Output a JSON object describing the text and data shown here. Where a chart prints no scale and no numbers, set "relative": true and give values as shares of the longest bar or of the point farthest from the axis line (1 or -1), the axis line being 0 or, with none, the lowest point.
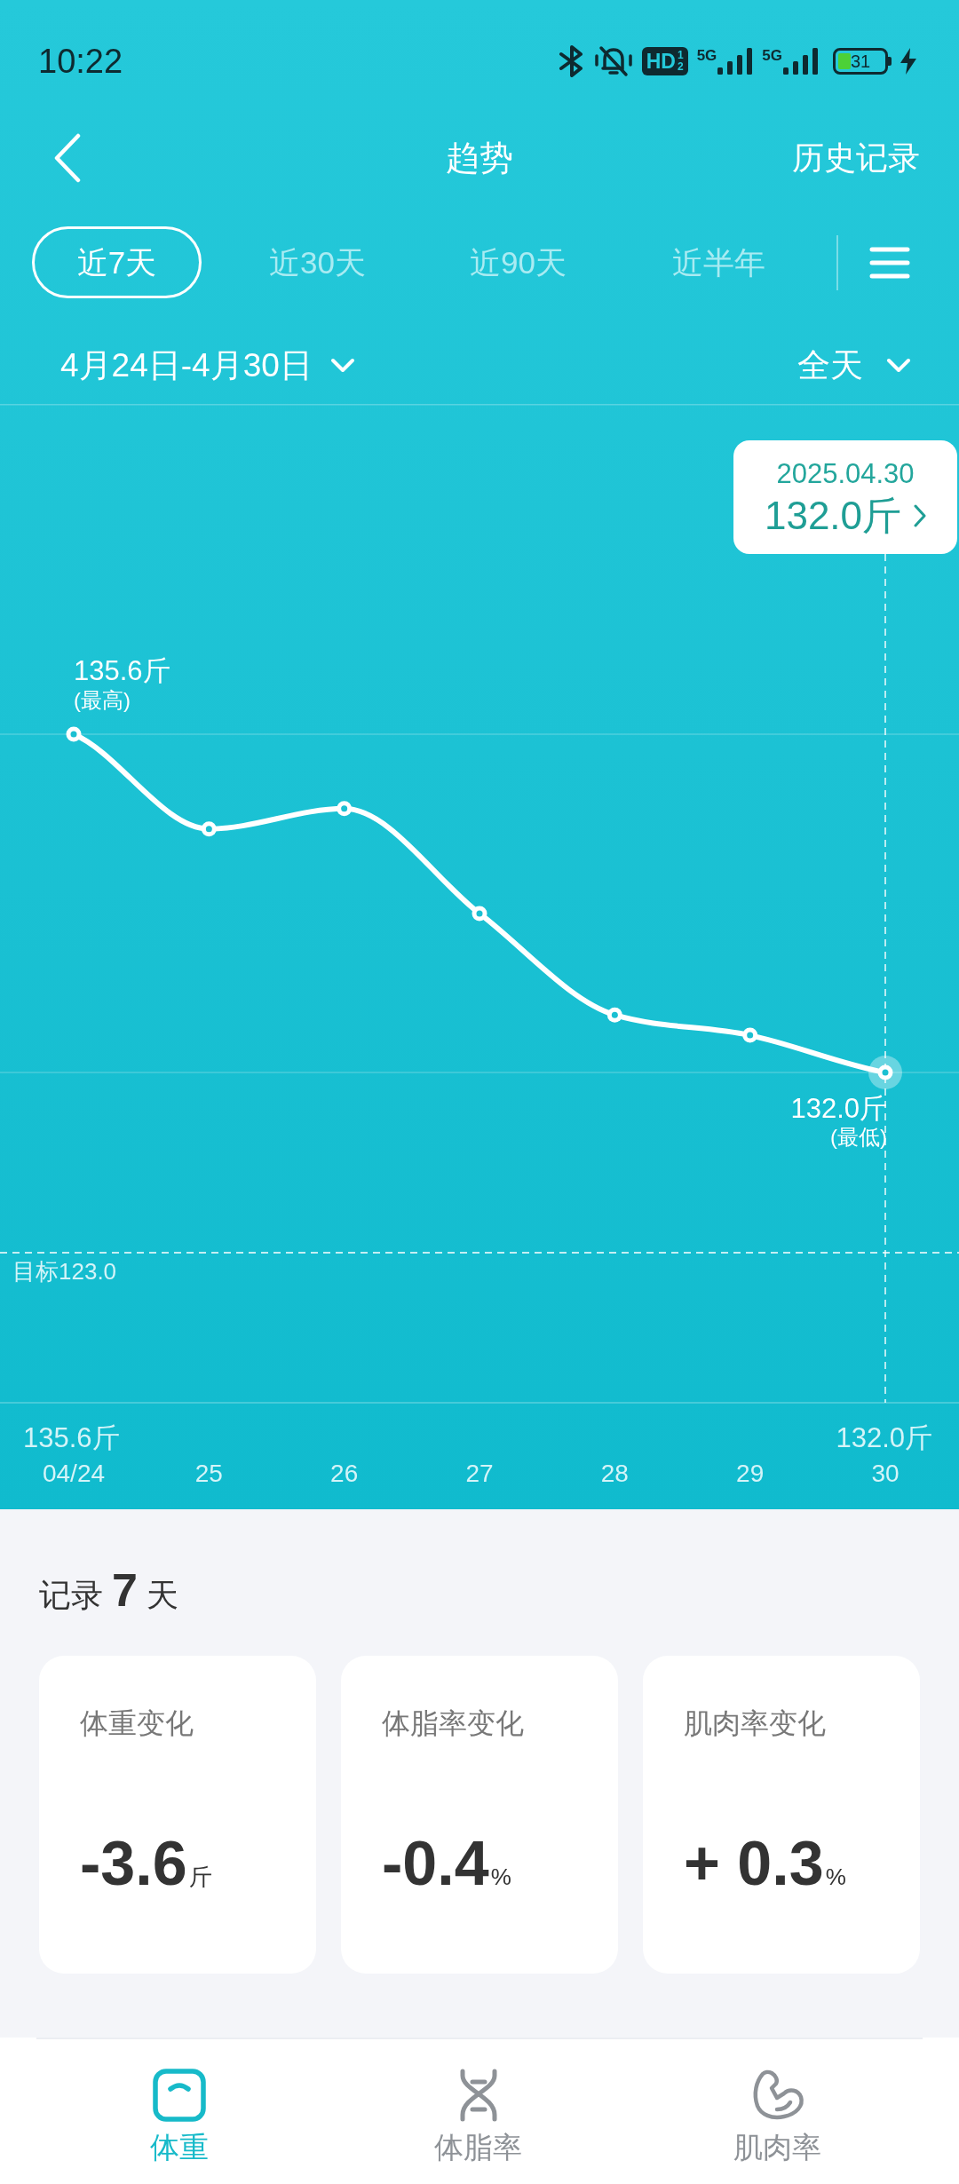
{
  "status_bar": {
    "time": "10:22",
    "hd_badge": "HD",
    "hd_sims": [
      "1",
      "2"
    ],
    "networks": [
      "5G",
      "5G"
    ],
    "battery": "31"
  },
  "header": {
    "title": "趋势",
    "action": "历史记录"
  },
  "range_tabs": [
    {
      "label": "近7天",
      "selected": true
    },
    {
      "label": "近30天",
      "selected": false
    },
    {
      "label": "近90天",
      "selected": false
    },
    {
      "label": "近半年",
      "selected": false
    }
  ],
  "filters": {
    "date_range": "4月24日-4月30日",
    "time_of_day": "全天"
  },
  "chart": {
    "tooltip": {
      "date": "2025.04.30",
      "value": "132.0斤"
    },
    "max_label": {
      "value": "135.6斤",
      "note": "(最高)"
    },
    "min_label": {
      "value": "132.0斤",
      "note": "(最低)"
    },
    "goal_label": "目标123.0",
    "start_value": "135.6斤",
    "end_value": "132.0斤",
    "points": [
      {
        "selected": false
      },
      {
        "selected": false
      },
      {
        "selected": false
      },
      {
        "selected": false
      },
      {
        "selected": false
      },
      {
        "selected": false
      },
      {
        "selected": true
      }
    ],
    "chart_data": {
      "type": "line",
      "relative": true,
      "categories": [
        "04/24",
        "25",
        "26",
        "27",
        "28",
        "29",
        "30"
      ],
      "series": [
        {
          "color": "#ffffff",
          "marker": true,
          "values": [
            1.0,
            0.72,
            0.78,
            0.47,
            0.17,
            0.11,
            0.0
          ]
        }
      ]
    }
  },
  "records": {
    "title": "记录 **7** 天"
  },
  "stats": [
    {
      "label": "体重变化",
      "value": "-3.6",
      "unit": "斤"
    },
    {
      "label": "体脂率变化",
      "value": "-0.4",
      "unit": "%"
    },
    {
      "label": "肌肉率变化",
      "value": "+ 0.3",
      "unit": "%"
    }
  ],
  "bottom_nav": [
    {
      "label": "体重",
      "selected": true
    },
    {
      "label": "体脂率",
      "selected": false
    },
    {
      "label": "肌肉率",
      "selected": false
    }
  ]
}
